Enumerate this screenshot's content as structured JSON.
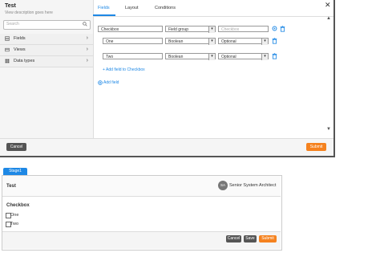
{
  "modal": {
    "title": "Test",
    "description": "View description goes here",
    "search_placeholder": "Search",
    "nav": [
      {
        "label": "Fields"
      },
      {
        "label": "Views"
      },
      {
        "label": "Data types"
      }
    ],
    "tabs": [
      {
        "label": "Fields"
      },
      {
        "label": "Layout"
      },
      {
        "label": "Conditions"
      }
    ],
    "fields": {
      "row0": {
        "name": "Checkbox",
        "type": "Field group",
        "extra_placeholder": "Checkbox"
      },
      "row1": {
        "name": "One",
        "type": "Boolean",
        "req": "Optional"
      },
      "row2": {
        "name": "Two",
        "type": "Boolean",
        "req": "Optional"
      },
      "add_to_checkbox": "+ Add field to Checkbox",
      "add_field": "Add field"
    },
    "cancel": "Cancel",
    "submit": "Submit"
  },
  "preview": {
    "stage": "Stage1",
    "title": "Test",
    "avatar": "SA",
    "role": "Senior System Architect",
    "group_title": "Checkbox",
    "options": [
      {
        "label": "One"
      },
      {
        "label": "Two"
      }
    ],
    "cancel": "Cancel",
    "save": "Save",
    "submit": "Submit"
  },
  "colors": {
    "accent": "#1e88e5",
    "submit": "#f5821f",
    "cancel": "#555555"
  }
}
